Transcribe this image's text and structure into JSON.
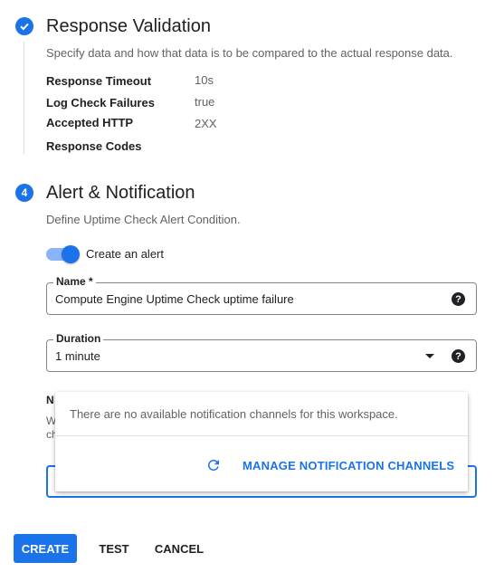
{
  "response_validation": {
    "title": "Response Validation",
    "description": "Specify data and how that data is to be compared to the actual response data.",
    "fields": [
      {
        "key": "Response Timeout",
        "value": "10s"
      },
      {
        "key": "Log Check Failures",
        "value": "true"
      },
      {
        "key": "Accepted HTTP Response Codes",
        "value": "2XX"
      }
    ]
  },
  "alert": {
    "step_number": "4",
    "title": "Alert & Notification",
    "description": "Define Uptime Check Alert Condition.",
    "toggle_label": "Create an alert",
    "toggle_on": true,
    "name_label": "Name *",
    "name_value": "Compute Engine Uptime Check uptime failure",
    "duration_label": "Duration",
    "duration_value": "1 minute",
    "hidden_label_fragment": "N",
    "hidden_desc_fragment_1": "W",
    "hidden_desc_fragment_2": "ch"
  },
  "notification_popup": {
    "message": "There are no available notification channels for this workspace.",
    "manage_link": "MANAGE NOTIFICATION CHANNELS"
  },
  "actions": {
    "create": "CREATE",
    "test": "TEST",
    "cancel": "CANCEL"
  },
  "colors": {
    "accent": "#1a73e8",
    "text": "#202124",
    "muted": "#5f6368"
  }
}
